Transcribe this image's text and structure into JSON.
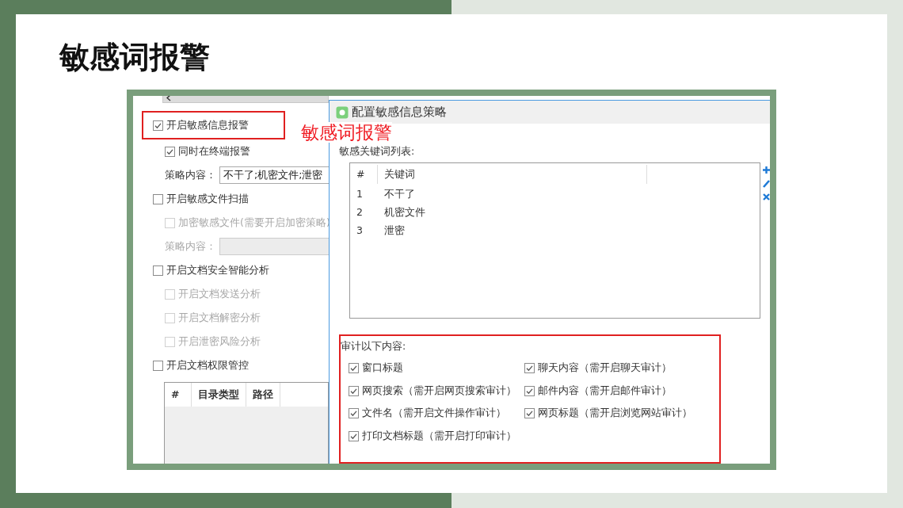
{
  "slide_title": "敏感词报警",
  "annotation": "敏感词报警",
  "settings": [
    {
      "kind": "checkbox",
      "label": "开启敏感信息报警",
      "checked": true,
      "disabled": false,
      "highlighted": true,
      "children": [
        {
          "kind": "checkbox",
          "label": "同时在终端报警",
          "checked": true,
          "disabled": false
        },
        {
          "kind": "field",
          "label": "策略内容：",
          "value": "不干了;机密文件;泄密",
          "disabled": false
        }
      ]
    },
    {
      "kind": "checkbox",
      "label": "开启敏感文件扫描",
      "checked": false,
      "disabled": false,
      "highlighted": false,
      "children": [
        {
          "kind": "checkbox",
          "label": "加密敏感文件(需要开启加密策略)",
          "checked": false,
          "disabled": true
        },
        {
          "kind": "field",
          "label": "策略内容：",
          "disabled": true
        }
      ]
    },
    {
      "kind": "checkbox",
      "label": "开启文档安全智能分析",
      "checked": false,
      "disabled": false,
      "highlighted": false,
      "children": [
        {
          "kind": "checkbox",
          "label": "开启文档发送分析",
          "checked": false,
          "disabled": true
        },
        {
          "kind": "checkbox",
          "label": "开启文档解密分析",
          "checked": false,
          "disabled": true
        },
        {
          "kind": "checkbox",
          "label": "开启泄密风险分析",
          "checked": false,
          "disabled": true
        }
      ]
    },
    {
      "kind": "checkbox",
      "label": "开启文档权限管控",
      "checked": false,
      "disabled": false,
      "highlighted": false
    }
  ],
  "dir_table": {
    "columns": [
      "#",
      "目录类型",
      "路径"
    ]
  },
  "dialog": {
    "title": "配置敏感信息策略",
    "keyword_list_label": "敏感关键词列表:",
    "keyword_table": {
      "columns": [
        "#",
        "关键词"
      ],
      "rows": [
        [
          "1",
          "不干了"
        ],
        [
          "2",
          "机密文件"
        ],
        [
          "3",
          "泄密"
        ]
      ]
    },
    "audit": {
      "label": "审计以下内容:",
      "highlighted": true,
      "items": [
        {
          "label": "窗口标题",
          "checked": true
        },
        {
          "label": "聊天内容（需开启聊天审计）",
          "checked": true
        },
        {
          "label": "网页搜索（需开启网页搜索审计）",
          "checked": true
        },
        {
          "label": "邮件内容（需开启邮件审计）",
          "checked": true
        },
        {
          "label": "文件名（需开启文件操作审计）",
          "checked": true
        },
        {
          "label": "网页标题（需开启浏览网站审计）",
          "checked": true
        },
        {
          "label": "打印文档标题（需开启打印审计）",
          "checked": true
        }
      ]
    }
  }
}
